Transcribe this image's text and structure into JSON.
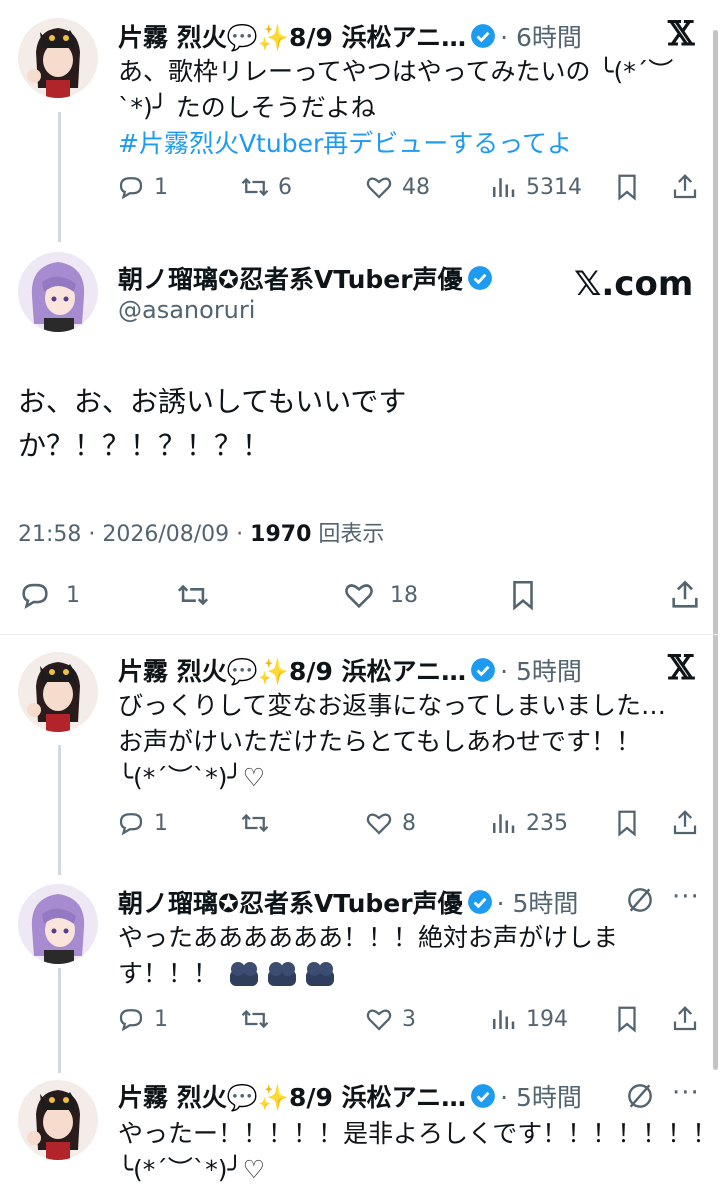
{
  "tweets": [
    {
      "name": "片霧 烈火💬✨8/9 浜松アニ…",
      "time": "· 6時間",
      "lines": [
        "あ、歌枠リレーってやつはやってみたいの ╰(*´︶`*)╯ たのしそうだよね"
      ],
      "line1": "あ、歌枠リレーってやつはやってみたいの ╰(*´︶",
      "line2": "`*)╯ たのしそうだよね",
      "hashtag": "#片霧烈火Vtuber再デビューするってよ",
      "reply": "1",
      "retweet": "6",
      "like": "48",
      "views": "5314"
    },
    {
      "name": "朝ノ瑠璃✪忍者系VTuber声優",
      "handle": "@asanoruri",
      "brand": "𝕏.com",
      "line1": "お、お、お誘いしてもいいです",
      "line2": "か？！？！？！？！",
      "timestamp": "21:58 · 2026/08/09 ·",
      "view_count": "1970",
      "view_label": "回表示",
      "reply": "1",
      "like": "18"
    },
    {
      "name": "片霧 烈火💬✨8/9 浜松アニ…",
      "time": "· 5時間",
      "line1": "びっくりして変なお返事になってしまいました…",
      "line2": "お声がけいただけたらとてもしあわせです！！",
      "line3": "╰(*´︶`*)╯♡",
      "reply": "1",
      "like": "8",
      "views": "235"
    },
    {
      "name": "朝ノ瑠璃✪忍者系VTuber声優",
      "time": "· 5時間",
      "line1": "やったああああああ！！！絶対お声がけしま",
      "line2": "す！！！",
      "reply": "1",
      "like": "3",
      "views": "194"
    },
    {
      "name": "片霧 烈火💬✨8/9 浜松アニ…",
      "time": "· 5時間",
      "line1": "やったー！！！！！是非よろしくです！！！！！！！",
      "line2": "╰(*´︶`*)╯♡"
    }
  ],
  "colors": {
    "accent": "#1d9bf0",
    "text": "#0f1419",
    "muted": "#536471",
    "line": "#cfd9de"
  }
}
